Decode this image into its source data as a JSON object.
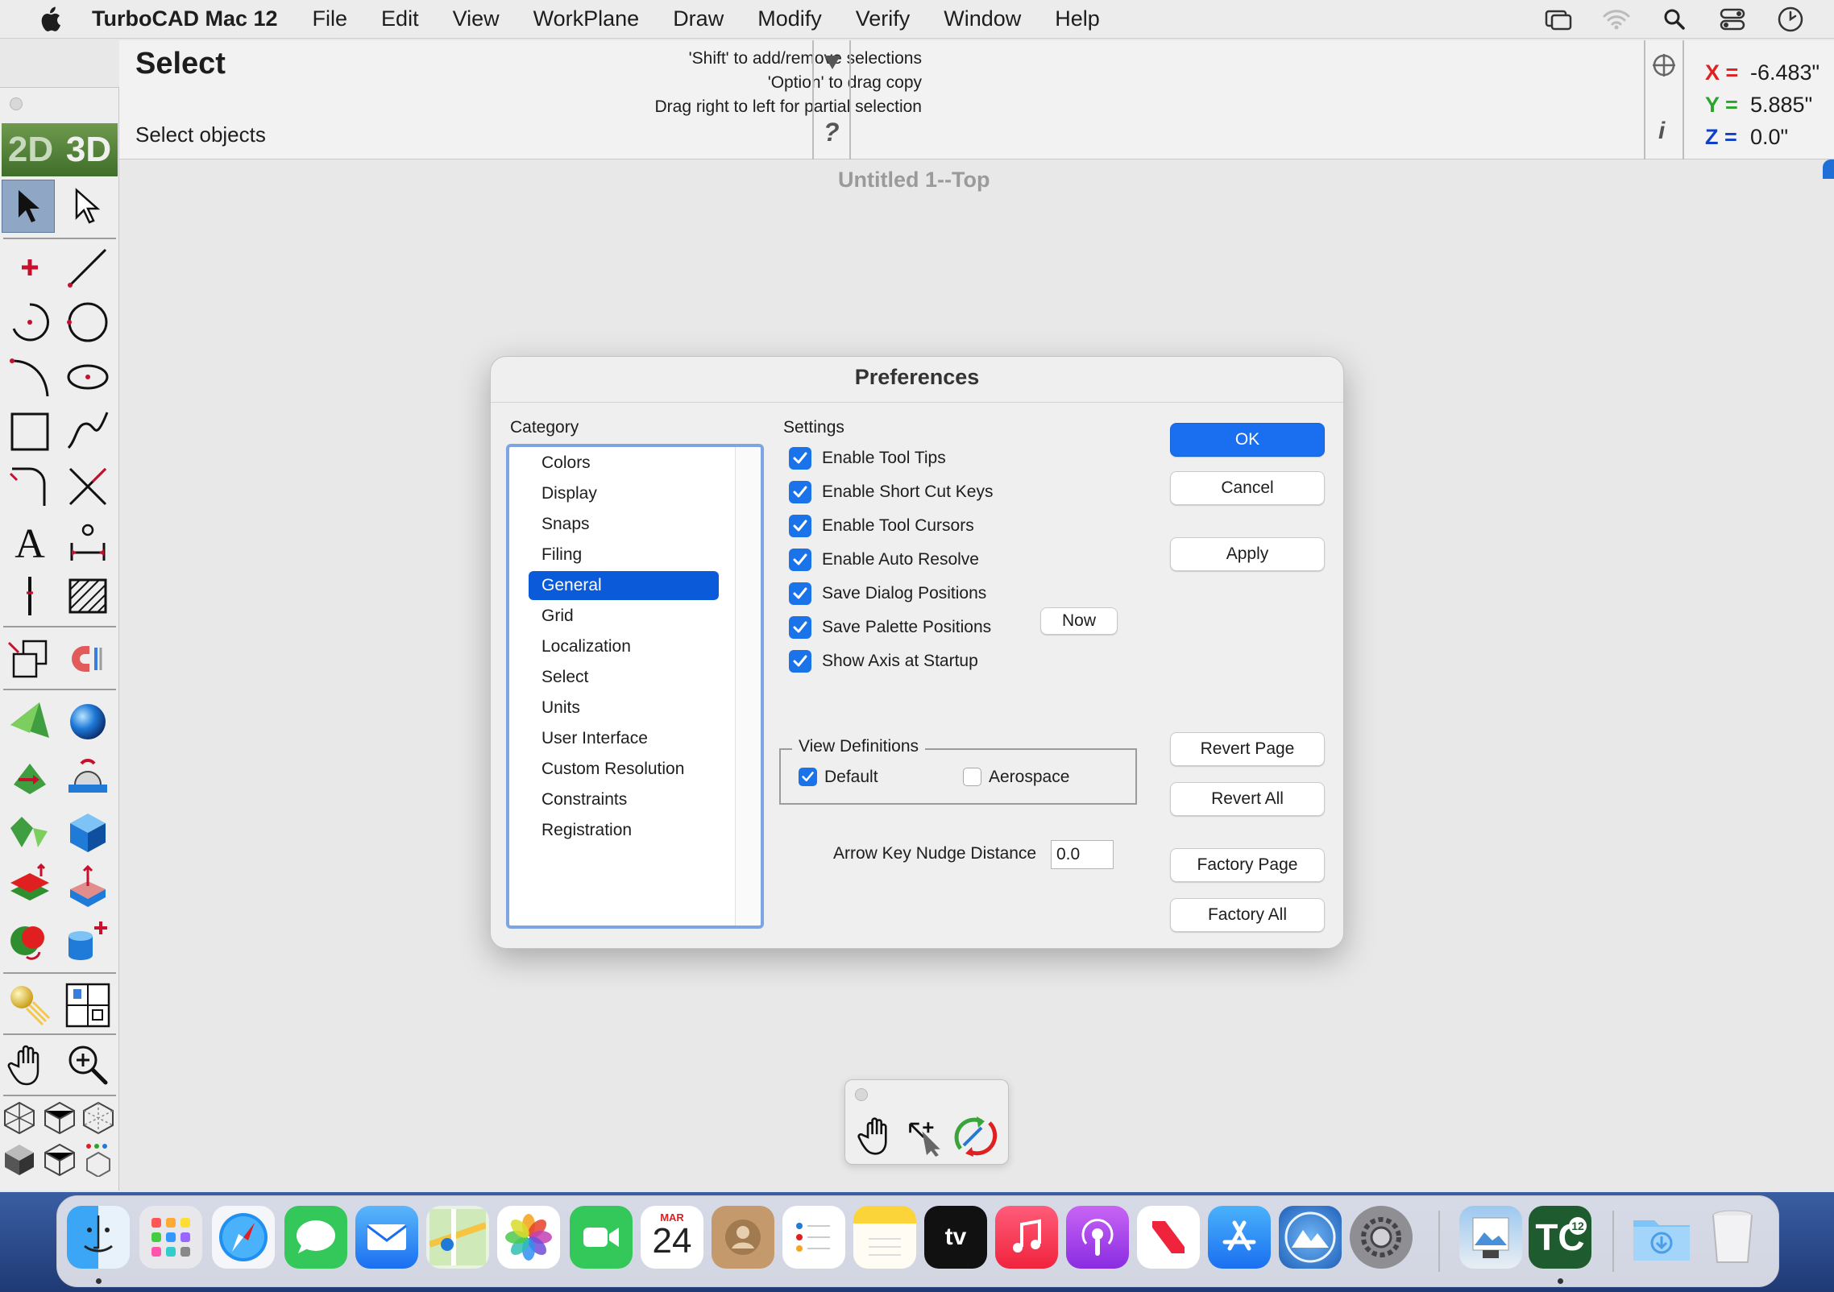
{
  "menubar": {
    "app_name": "TurboCAD Mac 12",
    "menus": [
      "File",
      "Edit",
      "View",
      "WorkPlane",
      "Draw",
      "Modify",
      "Verify",
      "Window",
      "Help"
    ]
  },
  "infobar": {
    "tool_title": "Select",
    "tool_prompt": "Select objects",
    "hints": [
      "'Shift' to add/remove selections",
      "'Option' to drag copy",
      "Drag right to left for partial selection"
    ],
    "help_glyph": "?",
    "info_glyph": "i",
    "coords": {
      "x_label": "X =",
      "x_value": "-6.483\"",
      "y_label": "Y =",
      "y_value": "5.885\"",
      "z_label": "Z =",
      "z_value": "0.0\""
    },
    "colors": {
      "x": "#e02020",
      "y": "#2aa52a",
      "z": "#1040c8"
    }
  },
  "palette": {
    "mode_2d": "2D",
    "mode_3d": "3D"
  },
  "canvas": {
    "title": "Untitled 1--Top"
  },
  "dialog": {
    "title": "Preferences",
    "category_label": "Category",
    "settings_label": "Settings",
    "categories": [
      "Colors",
      "Display",
      "Snaps",
      "Filing",
      "General",
      "Grid",
      "Localization",
      "Select",
      "Units",
      "User Interface",
      "Custom Resolution",
      "Constraints",
      "Registration"
    ],
    "selected_category": "General",
    "settings": [
      {
        "label": "Enable Tool Tips",
        "checked": true
      },
      {
        "label": "Enable Short Cut Keys",
        "checked": true
      },
      {
        "label": "Enable Tool Cursors",
        "checked": true
      },
      {
        "label": "Enable Auto Resolve",
        "checked": true
      },
      {
        "label": "Save Dialog Positions",
        "checked": true
      },
      {
        "label": "Save Palette Positions",
        "checked": true
      },
      {
        "label": "Show Axis at Startup",
        "checked": true
      }
    ],
    "now_button": "Now",
    "view_definitions": {
      "legend": "View Definitions",
      "default_label": "Default",
      "default_checked": true,
      "aerospace_label": "Aerospace",
      "aerospace_checked": false
    },
    "nudge": {
      "label": "Arrow Key Nudge Distance",
      "value": "0.0"
    },
    "buttons": {
      "ok": "OK",
      "cancel": "Cancel",
      "apply": "Apply",
      "revert_page": "Revert Page",
      "revert_all": "Revert All",
      "factory_page": "Factory Page",
      "factory_all": "Factory All"
    },
    "accent": "#1a6ff0"
  },
  "dock": {
    "calendar_month": "MAR",
    "calendar_day": "24",
    "tv_label": "tv",
    "turbocad_label": "TC",
    "turbocad_version": "12"
  }
}
